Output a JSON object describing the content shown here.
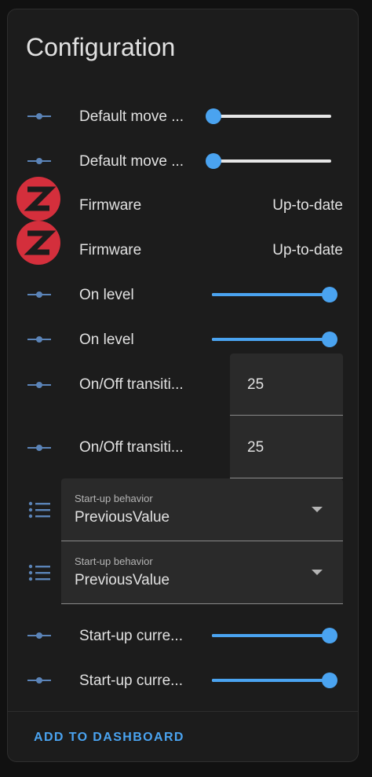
{
  "card": {
    "title": "Configuration",
    "footer_button": "ADD TO DASHBOARD"
  },
  "colors": {
    "accent": "#4aa3f0",
    "zlogo": "#d42f3c",
    "icon": "#5b84b8"
  },
  "rows": [
    {
      "label": "Default move ...",
      "type": "slider",
      "level": 0.0,
      "icon": "slider-icon"
    },
    {
      "label": "Default move ...",
      "type": "slider",
      "level": 0.0,
      "icon": "slider-icon"
    },
    {
      "label": "Firmware",
      "type": "text",
      "value": "Up-to-date",
      "icon": "zigbee-logo-icon"
    },
    {
      "label": "Firmware",
      "type": "text",
      "value": "Up-to-date",
      "icon": "zigbee-logo-icon"
    },
    {
      "label": "On level",
      "type": "slider",
      "level": 1.0,
      "icon": "slider-icon"
    },
    {
      "label": "On level",
      "type": "slider",
      "level": 1.0,
      "icon": "slider-icon"
    },
    {
      "label": "On/Off transiti...",
      "type": "number",
      "value": "25",
      "icon": "slider-icon"
    },
    {
      "label": "On/Off transiti...",
      "type": "number",
      "value": "25",
      "icon": "slider-icon"
    },
    {
      "type": "select",
      "field_label": "Start-up behavior",
      "value": "PreviousValue",
      "icon": "list-icon"
    },
    {
      "type": "select",
      "field_label": "Start-up behavior",
      "value": "PreviousValue",
      "icon": "list-icon"
    },
    {
      "label": "Start-up curre...",
      "type": "slider",
      "level": 1.0,
      "icon": "slider-icon"
    },
    {
      "label": "Start-up curre...",
      "type": "slider",
      "level": 1.0,
      "icon": "slider-icon"
    }
  ]
}
